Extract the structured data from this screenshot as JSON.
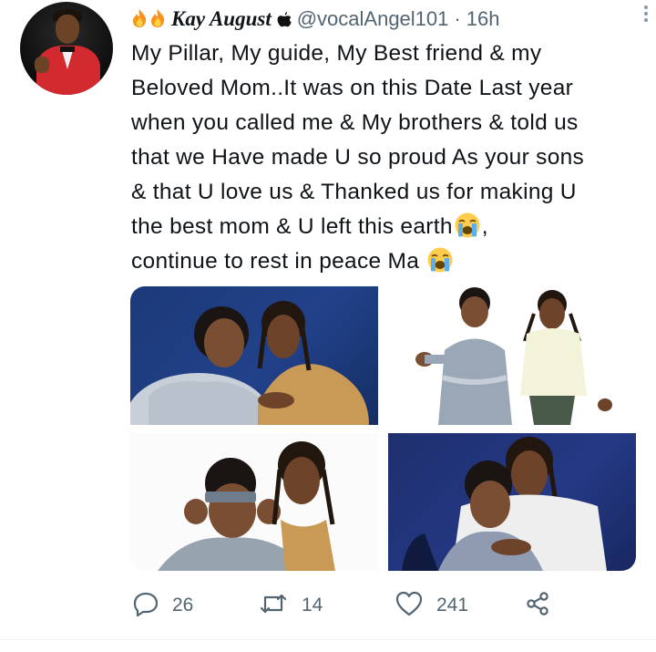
{
  "tweet": {
    "author_name": "Kay August",
    "handle": "@vocalAngel101",
    "separator": "·",
    "time": "16h",
    "text_lines": [
      "My Pillar, My guide, My Best friend & my",
      "Beloved Mom..It was on this Date Last year",
      "when you called me & My brothers & told us",
      "that we Have made U so proud As your sons",
      "& that U love us & Thanked us for making U",
      "the best mom & U left this earth",
      "continue to rest in peace Ma"
    ],
    "line6_suffix": ",",
    "emoji": "loudly-crying-face",
    "header_icons": [
      "fire-icon",
      "fire-icon",
      "apple-icon"
    ]
  },
  "media": {
    "photo_count": 4
  },
  "actions": {
    "replies": "26",
    "retweets": "14",
    "likes": "241"
  },
  "colors": {
    "text": "#0f1419",
    "secondary": "#536471",
    "photo_blue": "#21418a"
  }
}
